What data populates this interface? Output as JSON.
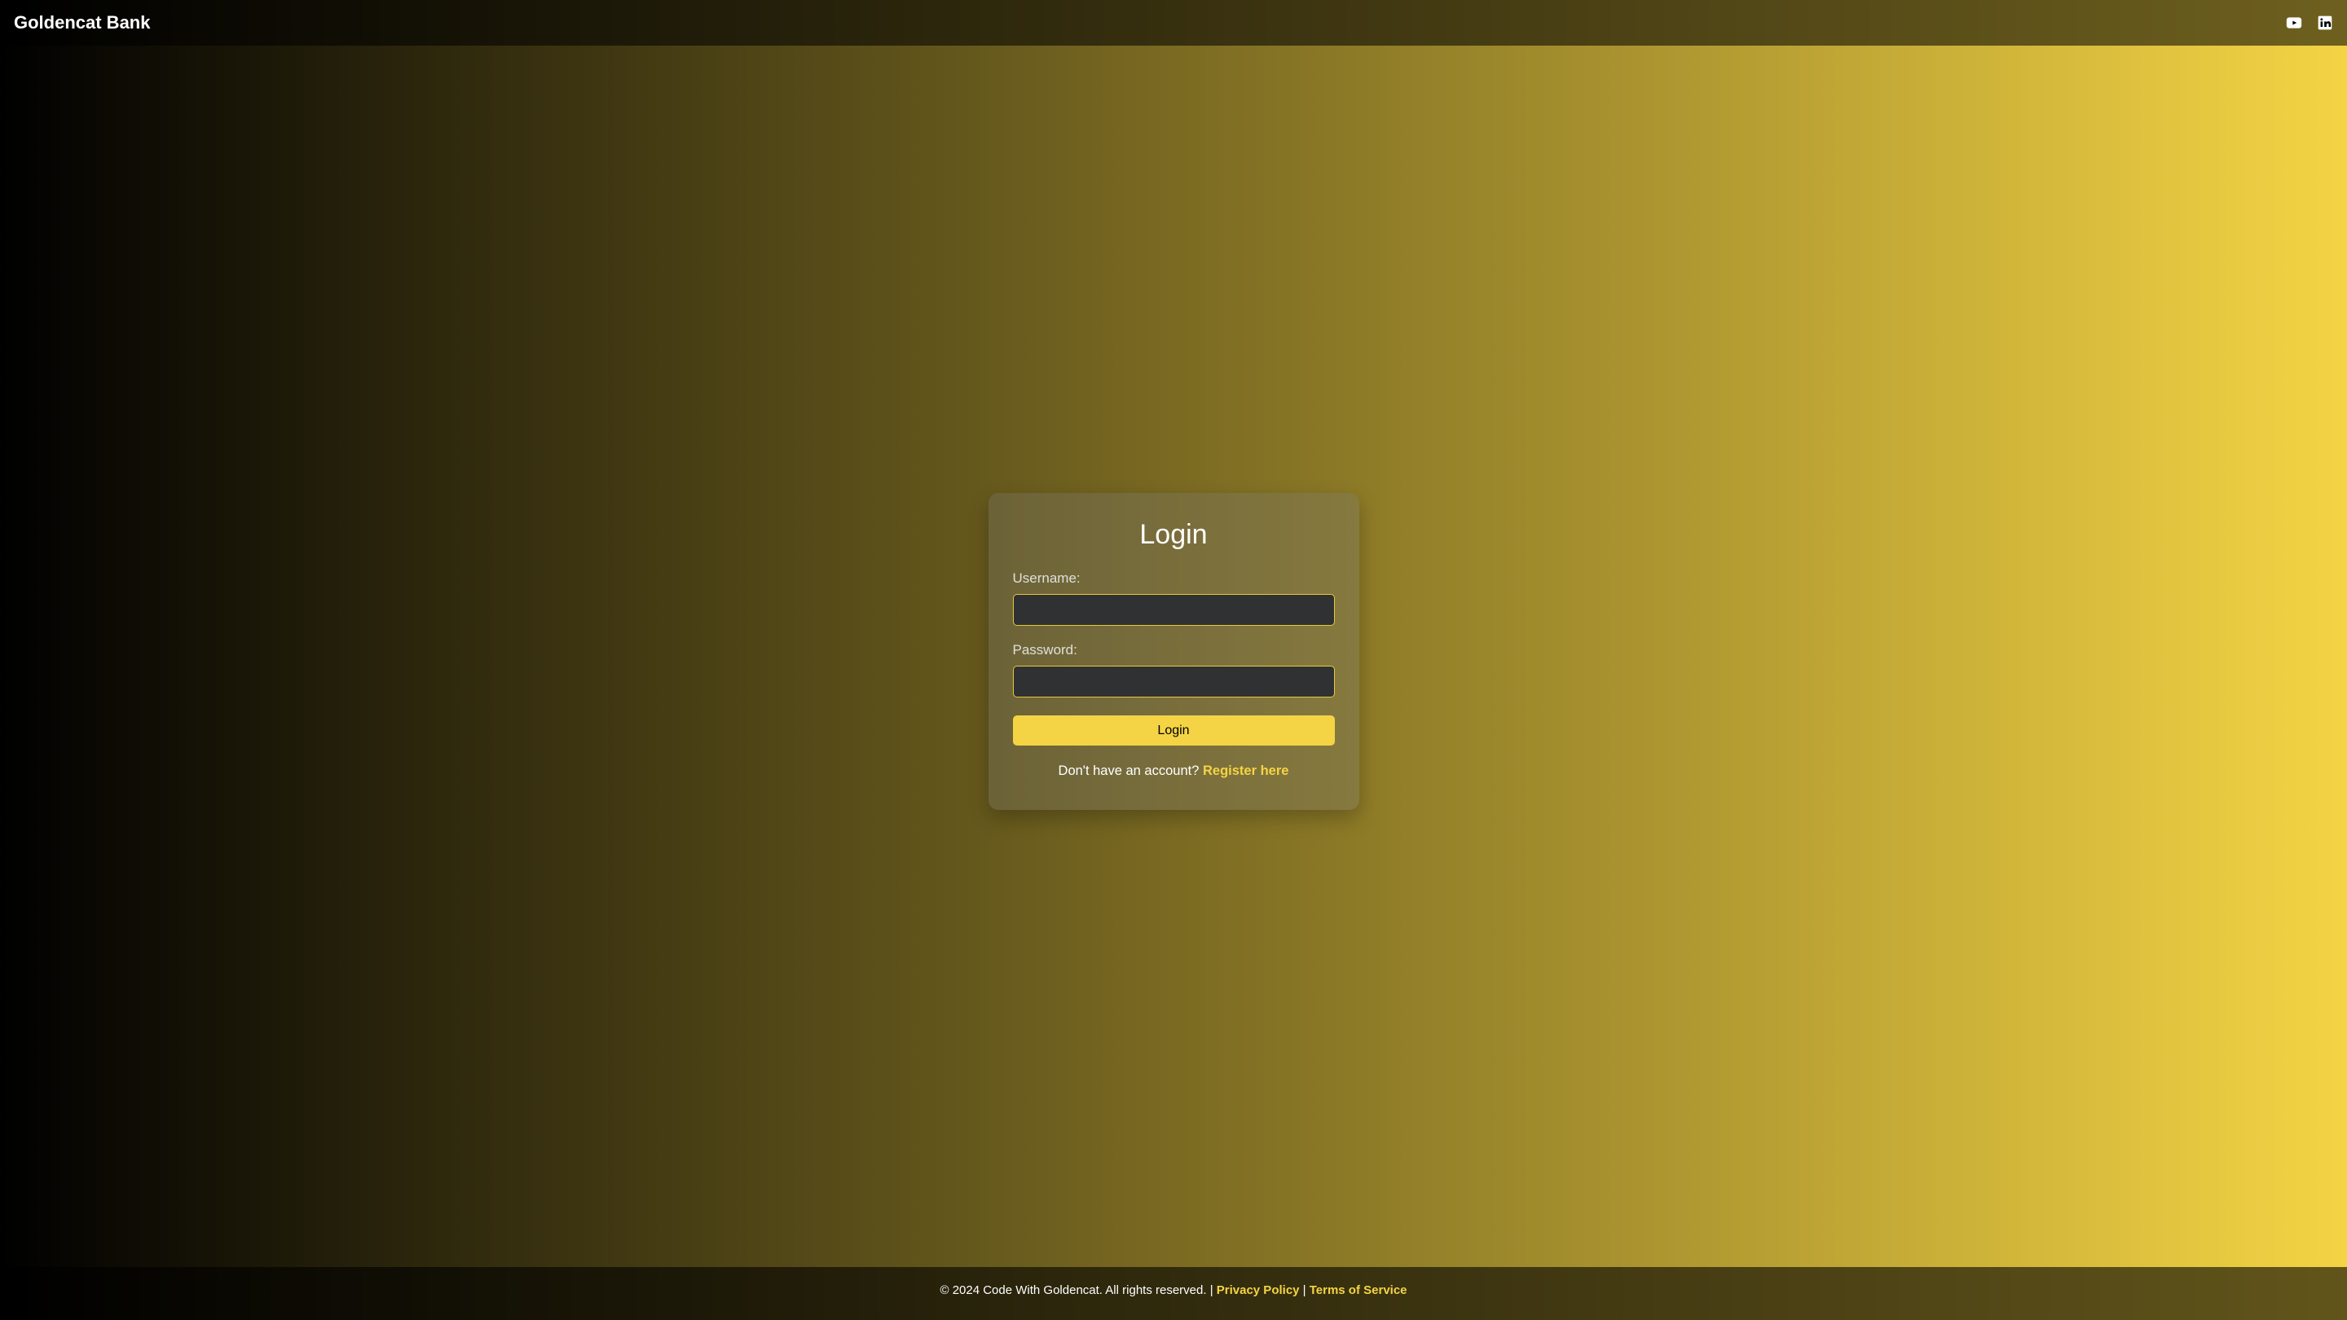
{
  "header": {
    "brand": "Goldencat Bank"
  },
  "login": {
    "title": "Login",
    "username_label": "Username:",
    "username_value": "",
    "password_label": "Password:",
    "password_value": "",
    "button_label": "Login",
    "signup_prompt": "Don't have an account? ",
    "signup_link_text": "Register here"
  },
  "footer": {
    "copyright": "© 2024 Code With Goldencat. All rights reserved.",
    "sep": " | ",
    "privacy_label": "Privacy Policy",
    "terms_label": "Terms of Service"
  },
  "colors": {
    "gold": "#f4d444",
    "dark": "#000000",
    "input_bg": "#2f3133"
  }
}
